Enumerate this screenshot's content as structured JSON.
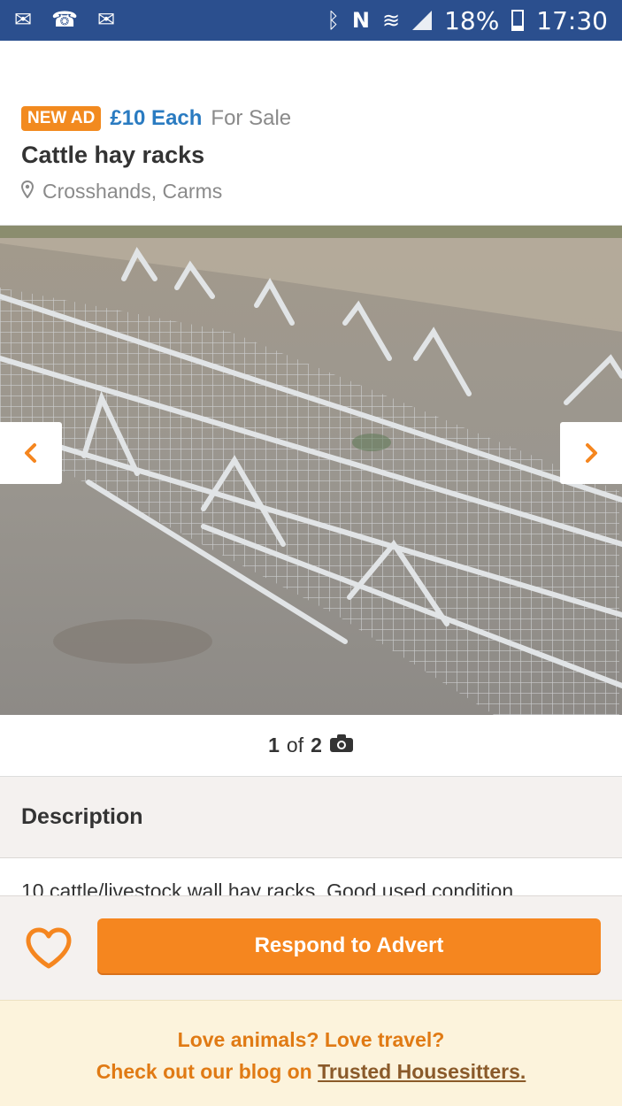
{
  "status_bar": {
    "battery": "18%",
    "time": "17:30",
    "icons": [
      "mail-at-icon",
      "missed-call-icon",
      "email-icon",
      "bluetooth-icon",
      "nfc-icon",
      "wifi-icon",
      "signal-icon",
      "battery-icon"
    ]
  },
  "listing": {
    "badge": "NEW AD",
    "price": "£10 Each",
    "sale_type": "For Sale",
    "title": "Cattle hay racks",
    "location": "Crosshands, Carms"
  },
  "gallery": {
    "current": "1",
    "of": "of",
    "total": "2"
  },
  "description": {
    "heading": "Description",
    "text": "10 cattle/livestock wall hay racks. Good used condition."
  },
  "actions": {
    "respond_label": "Respond to Advert"
  },
  "promo": {
    "line1": "Love animals? Love travel?",
    "line2_prefix": "Check out our blog on ",
    "link_text": "Trusted Housesitters."
  },
  "colors": {
    "status_bar": "#2b4f8e",
    "accent_orange": "#f5861f",
    "price_blue": "#2a7bc1",
    "promo_bg": "#fcf3dc"
  }
}
